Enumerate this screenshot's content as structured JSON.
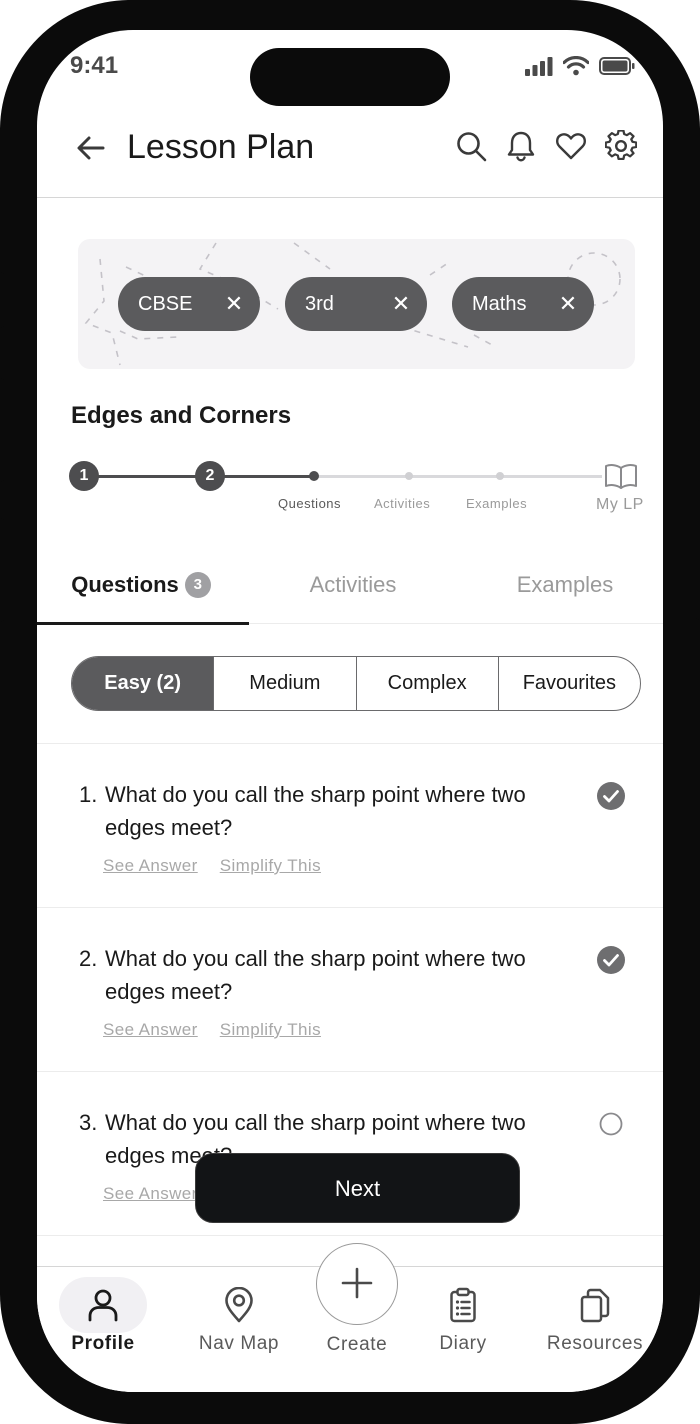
{
  "status_bar": {
    "time": "9:41"
  },
  "header": {
    "title": "Lesson Plan"
  },
  "chips": [
    {
      "label": "CBSE"
    },
    {
      "label": "3rd"
    },
    {
      "label": "Maths"
    }
  ],
  "chip_remove_glyph": "✕",
  "lesson": {
    "title": "Edges and Corners"
  },
  "stepper": {
    "steps": [
      "1",
      "2"
    ],
    "labels": [
      "Questions",
      "Activities",
      "Examples",
      "My LP"
    ]
  },
  "tabs": [
    {
      "label": "Questions",
      "badge": "3"
    },
    {
      "label": "Activities"
    },
    {
      "label": "Examples"
    }
  ],
  "filters": [
    "Easy (2)",
    "Medium",
    "Complex",
    "Favourites"
  ],
  "questions": [
    {
      "number": "1.",
      "text": "What do you call the sharp point where two edges meet?",
      "checked": true
    },
    {
      "number": "2.",
      "text": "What do you call the sharp point where two edges meet?",
      "checked": true
    },
    {
      "number": "3.",
      "text": "What do you call the sharp point where two edges meet?",
      "checked": false
    }
  ],
  "question_links": {
    "see_answer": "See Answer",
    "simplify": "Simplify This"
  },
  "next_button": {
    "label": "Next"
  },
  "bottom_nav": [
    {
      "label": "Profile",
      "icon": "person-icon"
    },
    {
      "label": "Nav Map",
      "icon": "location-pin-icon"
    },
    {
      "label": "Create",
      "icon": "plus-icon"
    },
    {
      "label": "Diary",
      "icon": "clipboard-icon"
    },
    {
      "label": "Resources",
      "icon": "copy-icon"
    }
  ],
  "colors": {
    "chip": "#5b5b5d",
    "active_filter": "#5b5b5d",
    "step": "#4d4d4f",
    "next_button": "#121416",
    "muted_text": "#a8a8a8"
  }
}
